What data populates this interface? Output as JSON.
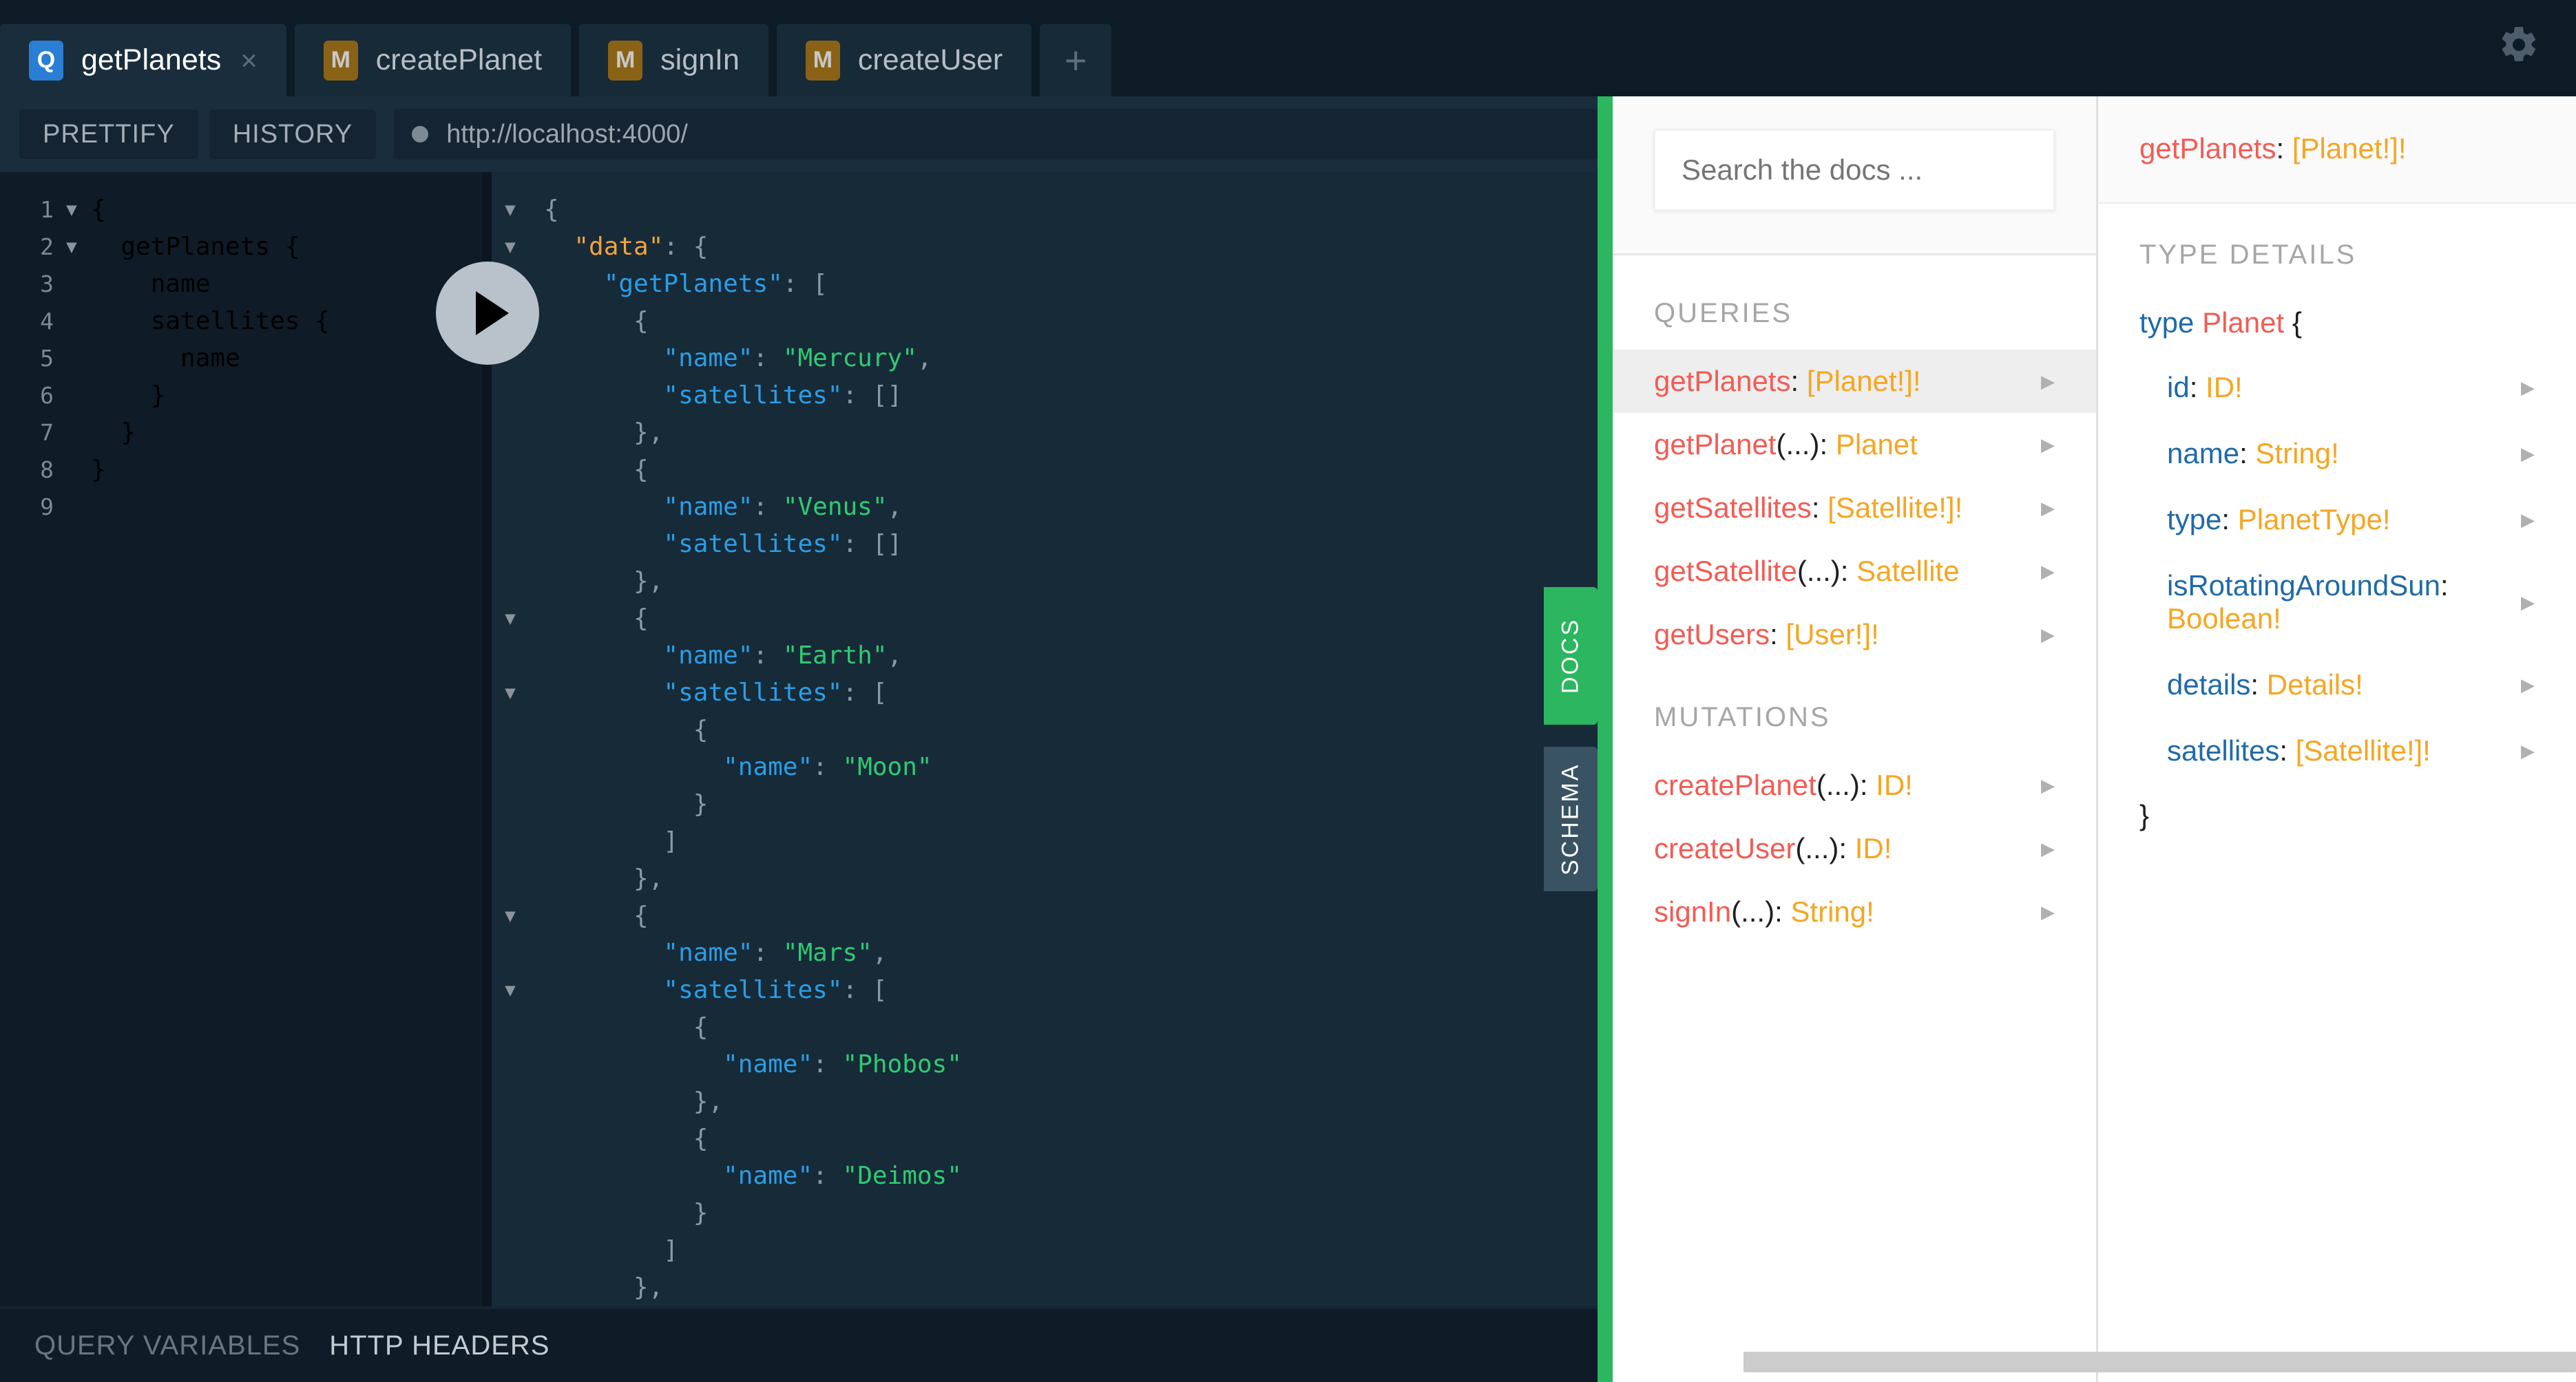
{
  "tabs": [
    {
      "badge": "Q",
      "badge_kind": "query",
      "label": "getPlanets",
      "active": true,
      "close": "×"
    },
    {
      "badge": "M",
      "badge_kind": "mutation",
      "label": "createPlanet",
      "active": false
    },
    {
      "badge": "M",
      "badge_kind": "mutation",
      "label": "signIn",
      "active": false
    },
    {
      "badge": "M",
      "badge_kind": "mutation",
      "label": "createUser",
      "active": false
    }
  ],
  "tab_add_label": "+",
  "gear_icon": "gear-icon",
  "toolbar": {
    "prettify_label": "PRETTIFY",
    "history_label": "HISTORY",
    "url": "http://localhost:4000/"
  },
  "query_editor": {
    "lines": [
      {
        "n": "1",
        "fold": "▼",
        "text": "{"
      },
      {
        "n": "2",
        "fold": "▼",
        "text": "  getPlanets {"
      },
      {
        "n": "3",
        "fold": "",
        "text": "    name"
      },
      {
        "n": "4",
        "fold": "",
        "text": "    satellites {"
      },
      {
        "n": "5",
        "fold": "",
        "text": "      name"
      },
      {
        "n": "6",
        "fold": "",
        "text": "    }"
      },
      {
        "n": "7",
        "fold": "",
        "text": "  }"
      },
      {
        "n": "8",
        "fold": "",
        "text": "}"
      },
      {
        "n": "9",
        "fold": "",
        "text": ""
      }
    ]
  },
  "response": {
    "lines": [
      {
        "fold": "▼",
        "text": "{"
      },
      {
        "fold": "▼",
        "text": "  \"data\": {"
      },
      {
        "fold": "▼",
        "text": "    \"getPlanets\": ["
      },
      {
        "fold": "",
        "text": "      {"
      },
      {
        "fold": "",
        "text": "        \"name\": \"Mercury\","
      },
      {
        "fold": "",
        "text": "        \"satellites\": []"
      },
      {
        "fold": "",
        "text": "      },"
      },
      {
        "fold": "",
        "text": "      {"
      },
      {
        "fold": "",
        "text": "        \"name\": \"Venus\","
      },
      {
        "fold": "",
        "text": "        \"satellites\": []"
      },
      {
        "fold": "",
        "text": "      },"
      },
      {
        "fold": "▼",
        "text": "      {"
      },
      {
        "fold": "",
        "text": "        \"name\": \"Earth\","
      },
      {
        "fold": "▼",
        "text": "        \"satellites\": ["
      },
      {
        "fold": "",
        "text": "          {"
      },
      {
        "fold": "",
        "text": "            \"name\": \"Moon\""
      },
      {
        "fold": "",
        "text": "          }"
      },
      {
        "fold": "",
        "text": "        ]"
      },
      {
        "fold": "",
        "text": "      },"
      },
      {
        "fold": "▼",
        "text": "      {"
      },
      {
        "fold": "",
        "text": "        \"name\": \"Mars\","
      },
      {
        "fold": "▼",
        "text": "        \"satellites\": ["
      },
      {
        "fold": "",
        "text": "          {"
      },
      {
        "fold": "",
        "text": "            \"name\": \"Phobos\""
      },
      {
        "fold": "",
        "text": "          },"
      },
      {
        "fold": "",
        "text": "          {"
      },
      {
        "fold": "",
        "text": "            \"name\": \"Deimos\""
      },
      {
        "fold": "",
        "text": "          }"
      },
      {
        "fold": "",
        "text": "        ]"
      },
      {
        "fold": "",
        "text": "      },"
      }
    ]
  },
  "play_button_label": "execute-query",
  "bottom_bar": {
    "query_variables_label": "QUERY VARIABLES",
    "http_headers_label": "HTTP HEADERS"
  },
  "side_tabs": {
    "docs_label": "DOCS",
    "schema_label": "SCHEMA"
  },
  "docs": {
    "search_placeholder": "Search the docs ...",
    "search_value": "",
    "queries_title": "QUERIES",
    "mutations_title": "MUTATIONS",
    "queries": [
      {
        "name": "getPlanets",
        "args": "",
        "sep": ": ",
        "type": "[Planet!]",
        "bang": "!",
        "selected": true
      },
      {
        "name": "getPlanet",
        "args": "(...)",
        "sep": ": ",
        "type": "Planet",
        "bang": "",
        "selected": false
      },
      {
        "name": "getSatellites",
        "args": "",
        "sep": ": ",
        "type": "[Satellite!]",
        "bang": "!",
        "selected": false
      },
      {
        "name": "getSatellite",
        "args": "(...)",
        "sep": ": ",
        "type": "Satellite",
        "bang": "",
        "selected": false
      },
      {
        "name": "getUsers",
        "args": "",
        "sep": ": ",
        "type": "[User!]",
        "bang": "!",
        "selected": false
      }
    ],
    "mutations": [
      {
        "name": "createPlanet",
        "args": "(...)",
        "sep": ": ",
        "type": "ID",
        "bang": "!",
        "selected": false
      },
      {
        "name": "createUser",
        "args": "(...)",
        "sep": ": ",
        "type": "ID",
        "bang": "!",
        "selected": false
      },
      {
        "name": "signIn",
        "args": "(...)",
        "sep": ": ",
        "type": "String",
        "bang": "!",
        "selected": false
      }
    ],
    "arrow_glyph": "▶"
  },
  "type_details": {
    "header_name": "getPlanets",
    "header_sep": ": ",
    "header_type": "[Planet!]!",
    "section_title": "TYPE DETAILS",
    "kw_type": "type",
    "type_name": "Planet",
    "open_brace": "{",
    "close_brace": "}",
    "fields": [
      {
        "field": "id",
        "sep": ": ",
        "type": "ID!"
      },
      {
        "field": "name",
        "sep": ": ",
        "type": "String!"
      },
      {
        "field": "type",
        "sep": ": ",
        "type": "PlanetType!"
      },
      {
        "field": "isRotatingAroundSun",
        "sep": ": ",
        "type": "Boolean!"
      },
      {
        "field": "details",
        "sep": ": ",
        "type": "Details!"
      },
      {
        "field": "satellites",
        "sep": ": ",
        "type": "[Satellite!]!"
      }
    ],
    "arrow_glyph": "▶"
  },
  "colors": {
    "accent_green": "#2cb65f",
    "query_blue": "#2a7ed3",
    "mutation_gold": "#8a6216",
    "field_red": "#f25c54",
    "type_orange": "#f5a623",
    "editor_bg": "#0f1b26",
    "response_bg": "#172a38"
  }
}
